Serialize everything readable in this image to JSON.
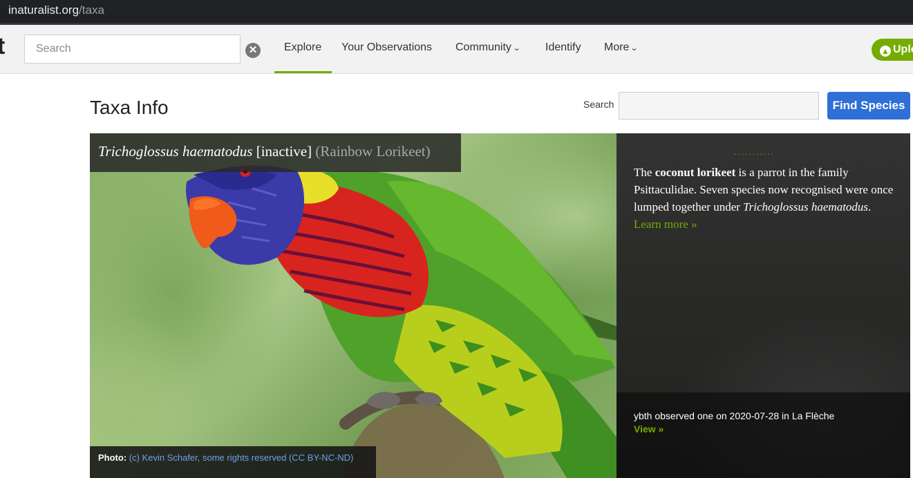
{
  "browser": {
    "url_host": "inaturalist.org",
    "url_path": "/taxa"
  },
  "header": {
    "logo_fragment": "t",
    "search_placeholder": "Search",
    "clear_symbol": "✕",
    "nav": {
      "explore": "Explore",
      "your_observations": "Your Observations",
      "community": "Community",
      "identify": "Identify",
      "more": "More"
    },
    "upload_label": "Uplo"
  },
  "page": {
    "title": "Taxa Info",
    "search_label": "Search",
    "find_species_label": "Find Species"
  },
  "hero": {
    "scientific_name": "Trichoglossus haematodus",
    "status": "[inactive]",
    "common_name": "(Rainbow Lorikeet)",
    "dots": "...........",
    "description": {
      "intro": "The ",
      "bold_name": "coconut lorikeet",
      "middle": " is a parrot in the family Psittaculidae. Seven species now recognised were once lumped together under ",
      "italic_name": "Trichoglossus haematodus",
      "period": ". ",
      "learn_more": "Learn more »"
    },
    "photo_credit": {
      "label": "Photo:",
      "text": "(c) Kevin Schafer, some rights reserved (CC BY-NC-ND)"
    },
    "observation": {
      "text": "ybth observed one on 2020-07-28 in La Flèche",
      "view": "View »"
    }
  },
  "colors": {
    "inat_green": "#74ac00",
    "find_blue": "#2f6fd6"
  }
}
